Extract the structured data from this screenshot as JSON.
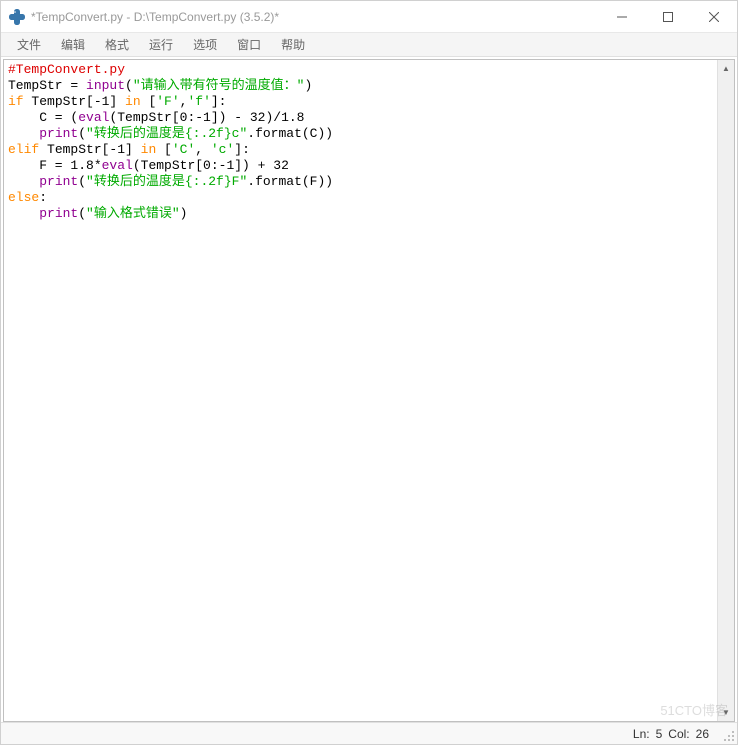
{
  "window": {
    "title": "*TempConvert.py - D:\\TempConvert.py (3.5.2)*"
  },
  "menu": {
    "items": [
      "文件",
      "编辑",
      "格式",
      "运行",
      "选项",
      "窗口",
      "帮助"
    ]
  },
  "code": {
    "l1_comment": "#TempConvert.py",
    "l2_a": "TempStr = ",
    "l2_builtin": "input",
    "l2_paren_open": "(",
    "l2_str": "\"请输入带有符号的温度值：\"",
    "l2_paren_close": ")",
    "l3_if": "if",
    "l3_a": " TempStr[-1] ",
    "l3_in": "in",
    "l3_b": " [",
    "l3_s1": "'F'",
    "l3_c": ",",
    "l3_s2": "'f'",
    "l3_d": "]:",
    "l4_a": "    C = (",
    "l4_eval": "eval",
    "l4_b": "(TempStr[0:-1]) - 32)/1.8",
    "l5_a": "    ",
    "l5_print": "print",
    "l5_b": "(",
    "l5_str": "\"转换后的温度是{:.2f}c\"",
    "l5_c": ".format(C))",
    "l6_elif": "elif",
    "l6_a": " TempStr[-1] ",
    "l6_in": "in",
    "l6_b": " [",
    "l6_s1": "'C'",
    "l6_c": ", ",
    "l6_s2": "'c'",
    "l6_d": "]:",
    "l7_a": "    F = 1.8*",
    "l7_eval": "eval",
    "l7_b": "(TempStr[0:-1]) + 32",
    "l8_a": "    ",
    "l8_print": "print",
    "l8_b": "(",
    "l8_str": "\"转换后的温度是{:.2f}F\"",
    "l8_c": ".format(F))",
    "l9_else": "else",
    "l9_colon": ":",
    "l10_a": "    ",
    "l10_print": "print",
    "l10_b": "(",
    "l10_str": "\"输入格式错误\"",
    "l10_c": ")"
  },
  "status": {
    "ln_label": "Ln:",
    "ln_value": "5",
    "col_label": "Col:",
    "col_value": "26"
  },
  "watermark": "51CTO博客"
}
